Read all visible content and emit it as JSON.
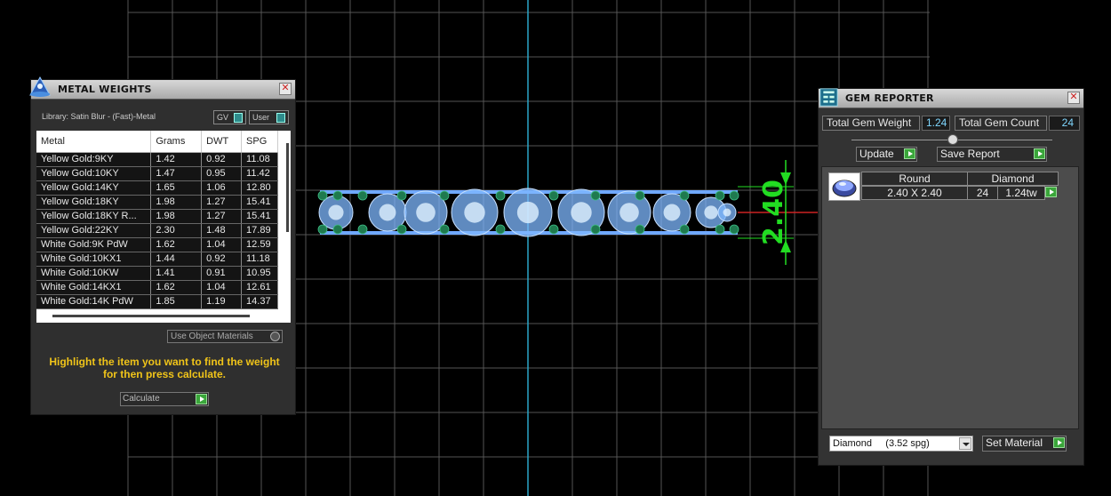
{
  "colors": {
    "grid": "#555555",
    "axis_cyan": "#2aa6c8",
    "dimension_green": "#22dd22",
    "gem_blue": "#7fb8ff",
    "prong_green": "#1f7a4f",
    "hint_yellow": "#f0c419",
    "value_cyan": "#7fd7ff"
  },
  "viewport": {
    "dimension_label": "2.40"
  },
  "metal_weights": {
    "title": "METAL WEIGHTS",
    "library": "Library: Satin Blur - (Fast)-Metal",
    "toggle_gv": "GV",
    "toggle_user": "User",
    "columns": [
      "Metal",
      "Grams",
      "DWT",
      "SPG"
    ],
    "rows": [
      [
        "Yellow Gold:9KY",
        "1.42",
        "0.92",
        "11.08"
      ],
      [
        "Yellow Gold:10KY",
        "1.47",
        "0.95",
        "11.42"
      ],
      [
        "Yellow Gold:14KY",
        "1.65",
        "1.06",
        "12.80"
      ],
      [
        "Yellow Gold:18KY",
        "1.98",
        "1.27",
        "15.41"
      ],
      [
        "Yellow Gold:18KY R...",
        "1.98",
        "1.27",
        "15.41"
      ],
      [
        "Yellow Gold:22KY",
        "2.30",
        "1.48",
        "17.89"
      ],
      [
        "White Gold:9K PdW",
        "1.62",
        "1.04",
        "12.59"
      ],
      [
        "White Gold:10KX1",
        "1.44",
        "0.92",
        "11.18"
      ],
      [
        "White Gold:10KW",
        "1.41",
        "0.91",
        "10.95"
      ],
      [
        "White Gold:14KX1",
        "1.62",
        "1.04",
        "12.61"
      ],
      [
        "White Gold:14K PdW",
        "1.85",
        "1.19",
        "14.37"
      ]
    ],
    "use_object_materials": "Use Object Materials",
    "hint_line1": "Highlight the item you want to find the weight",
    "hint_line2": "for then press calculate.",
    "calculate_label": "Calculate"
  },
  "gem_reporter": {
    "title": "GEM REPORTER",
    "total_weight_label": "Total Gem Weight",
    "total_weight_value": "1.24",
    "total_count_label": "Total Gem Count",
    "total_count_value": "24",
    "update_label": "Update",
    "save_report_label": "Save Report",
    "gem_entry": {
      "shape": "Round",
      "material": "Diamond",
      "size": "2.40 X 2.40",
      "count": "24",
      "weight": "1.24tw"
    },
    "material_select": "Diamond     (3.52 spg)",
    "set_material_label": "Set Material"
  }
}
